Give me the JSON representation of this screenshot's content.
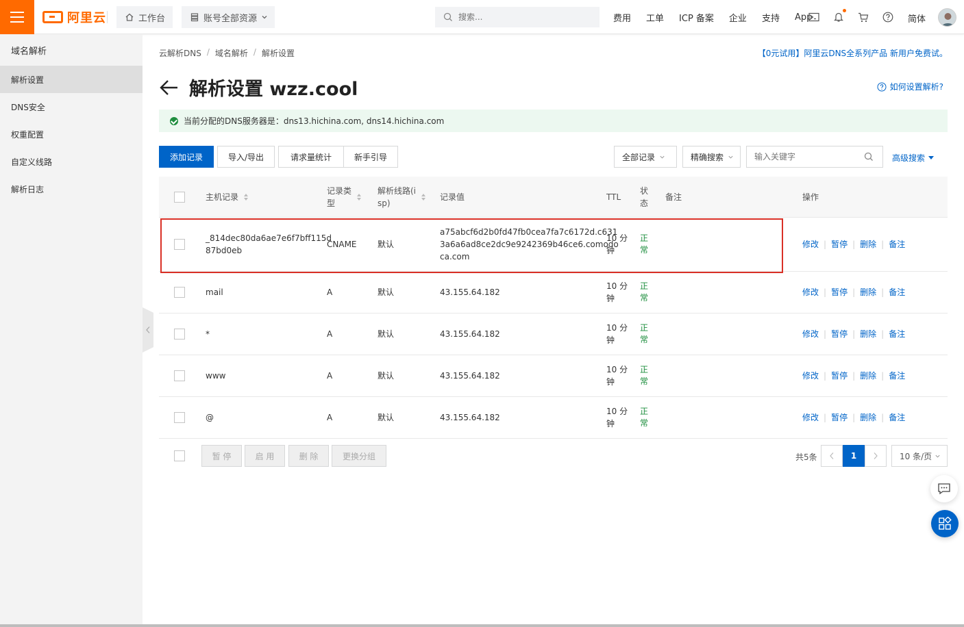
{
  "header": {
    "logo_text": "阿里云",
    "workbench_label": "工作台",
    "resources_label": "账号全部资源",
    "search_placeholder": "搜索...",
    "links": [
      "费用",
      "工单",
      "ICP 备案",
      "企业",
      "支持",
      "App"
    ],
    "language": "简体"
  },
  "sidebar": {
    "title": "域名解析",
    "items": [
      {
        "label": "解析设置",
        "active": true
      },
      {
        "label": "DNS安全"
      },
      {
        "label": "权重配置"
      },
      {
        "label": "自定义线路"
      },
      {
        "label": "解析日志"
      }
    ]
  },
  "breadcrumb": [
    "云解析DNS",
    "域名解析",
    "解析设置"
  ],
  "promo_text": "【0元试用】阿里云DNS全系列产品 新用户免费试。",
  "page": {
    "title": "解析设置 wzz.cool",
    "help_text": "如何设置解析?"
  },
  "notice": {
    "text": "当前分配的DNS服务器是：dns13.hichina.com, dns14.hichina.com",
    "color": "#ecf8f0"
  },
  "toolbar": {
    "add_record": "添加记录",
    "import_export": "导入/导出",
    "request_stats": "请求量统计",
    "guide": "新手引导",
    "filter_select": "全部记录",
    "search_mode": "精确搜索",
    "keyword_placeholder": "输入关键字",
    "advanced_search": "高级搜索"
  },
  "table": {
    "columns": {
      "host": "主机记录",
      "type_l1": "记录类",
      "type_l2": "型",
      "line_l1": "解析线路(i",
      "line_l2": "sp)",
      "value": "记录值",
      "ttl": "TTL",
      "status_l1": "状",
      "status_l2": "态",
      "remark": "备注",
      "actions": "操作"
    },
    "rows": [
      {
        "host_l1": "_814dec80da6ae7e6f7bff115d",
        "host_l2": "87bd0eb",
        "type": "CNAME",
        "line": "默认",
        "value_l1": "a75abcf6d2b0fd47fb0cea7fa7c6172d.c631",
        "value_l2": "3a6a6ad8ce2dc9e9242369b46ce6.comodo",
        "value_l3": "ca.com",
        "ttl_l1": "10 分",
        "ttl_l2": "钟",
        "status_l1": "正",
        "status_l2": "常",
        "remark": ""
      },
      {
        "host_l1": "mail",
        "host_l2": "",
        "type": "A",
        "line": "默认",
        "value_l1": "43.155.64.182",
        "value_l2": "",
        "value_l3": "",
        "ttl_l1": "10 分",
        "ttl_l2": "钟",
        "status_l1": "正",
        "status_l2": "常",
        "remark": ""
      },
      {
        "host_l1": "*",
        "host_l2": "",
        "type": "A",
        "line": "默认",
        "value_l1": "43.155.64.182",
        "value_l2": "",
        "value_l3": "",
        "ttl_l1": "10 分",
        "ttl_l2": "钟",
        "status_l1": "正",
        "status_l2": "常",
        "remark": ""
      },
      {
        "host_l1": "www",
        "host_l2": "",
        "type": "A",
        "line": "默认",
        "value_l1": "43.155.64.182",
        "value_l2": "",
        "value_l3": "",
        "ttl_l1": "10 分",
        "ttl_l2": "钟",
        "status_l1": "正",
        "status_l2": "常",
        "remark": ""
      },
      {
        "host_l1": "@",
        "host_l2": "",
        "type": "A",
        "line": "默认",
        "value_l1": "43.155.64.182",
        "value_l2": "",
        "value_l3": "",
        "ttl_l1": "10 分",
        "ttl_l2": "钟",
        "status_l1": "正",
        "status_l2": "常",
        "remark": ""
      }
    ],
    "row_actions": [
      "修改",
      "暂停",
      "删除",
      "备注"
    ]
  },
  "footer": {
    "batch_buttons": [
      "暂 停",
      "启 用",
      "删 除",
      "更换分组"
    ],
    "total": "共5条",
    "current_page": "1",
    "page_size": "10 条/页"
  },
  "colors": {
    "brand": "#ff6a00",
    "primary": "#0064c8",
    "status_ok": "#1e8e3e",
    "highlight": "#d93026"
  }
}
